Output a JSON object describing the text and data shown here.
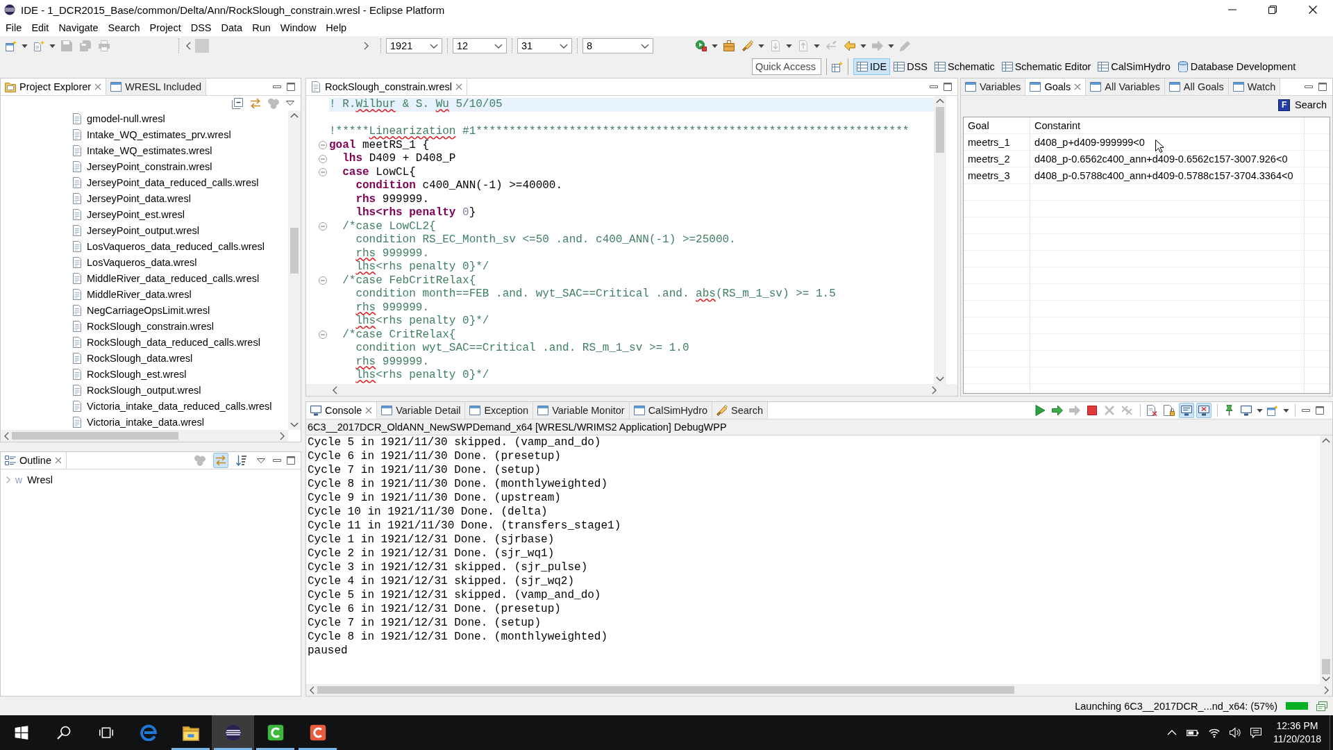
{
  "window": {
    "title": "IDE - 1_DCR2015_Base/common/Delta/Ann/RockSlough_constrain.wresl - Eclipse Platform"
  },
  "menu": [
    "File",
    "Edit",
    "Navigate",
    "Search",
    "Project",
    "DSS",
    "Data",
    "Run",
    "Window",
    "Help"
  ],
  "toolbar": {
    "tools_left": [
      {
        "kind": "new-window",
        "disabled": false,
        "dropdown": true
      },
      {
        "kind": "new-file",
        "disabled": false,
        "dropdown": true
      },
      {
        "kind": "save",
        "disabled": true,
        "dropdown": false
      },
      {
        "kind": "save-all",
        "disabled": true,
        "dropdown": false
      },
      {
        "kind": "print",
        "disabled": true,
        "dropdown": false
      }
    ],
    "combos": [
      {
        "value": "1921"
      },
      {
        "value": "12"
      },
      {
        "value": "31"
      },
      {
        "value": "8"
      }
    ],
    "tools_right": [
      {
        "kind": "run",
        "disabled": false,
        "dropdown": true
      },
      {
        "kind": "briefcase",
        "disabled": false,
        "dropdown": false
      },
      {
        "kind": "flashlight",
        "disabled": false,
        "dropdown": true
      },
      {
        "kind": "next-doc",
        "disabled": true,
        "dropdown": true
      },
      {
        "kind": "prev-doc",
        "disabled": true,
        "dropdown": true
      },
      {
        "kind": "arrow-pencil",
        "disabled": true,
        "dropdown": false
      },
      {
        "kind": "back",
        "disabled": false,
        "dropdown": true
      },
      {
        "kind": "forward",
        "disabled": true,
        "dropdown": true
      },
      {
        "kind": "pencil",
        "disabled": true,
        "dropdown": false
      }
    ],
    "quick_access": {
      "placeholder": "Quick Access"
    }
  },
  "perspectives": [
    {
      "label": "IDE",
      "kind": "table",
      "selected": true
    },
    {
      "label": "DSS",
      "kind": "table",
      "selected": false
    },
    {
      "label": "Schematic",
      "kind": "table",
      "selected": false
    },
    {
      "label": "Schematic Editor",
      "kind": "table",
      "selected": false
    },
    {
      "label": "CalSimHydro",
      "kind": "table",
      "selected": false
    },
    {
      "label": "Database Development",
      "kind": "database",
      "selected": false
    }
  ],
  "project_explorer": {
    "tabs": [
      {
        "label": "Project Explorer",
        "kind": "folder",
        "selected": true
      },
      {
        "label": "WRESL Included",
        "kind": "window",
        "selected": false
      }
    ],
    "tools": [
      {
        "kind": "collapse-all",
        "disabled": false
      },
      {
        "kind": "sync",
        "disabled": false
      },
      {
        "kind": "circles",
        "disabled": true
      },
      {
        "kind": "view-menu",
        "disabled": false
      }
    ],
    "files": [
      {
        "label": "gmodel-null.wresl",
        "selected": false
      },
      {
        "label": "Intake_WQ_estimates_prv.wresl",
        "selected": false
      },
      {
        "label": "Intake_WQ_estimates.wresl",
        "selected": false
      },
      {
        "label": "JerseyPoint_constrain.wresl",
        "selected": false
      },
      {
        "label": "JerseyPoint_data_reduced_calls.wresl",
        "selected": false
      },
      {
        "label": "JerseyPoint_data.wresl",
        "selected": false
      },
      {
        "label": "JerseyPoint_est.wresl",
        "selected": false
      },
      {
        "label": "JerseyPoint_output.wresl",
        "selected": false
      },
      {
        "label": "LosVaqueros_data_reduced_calls.wresl",
        "selected": false
      },
      {
        "label": "LosVaqueros_data.wresl",
        "selected": false
      },
      {
        "label": "MiddleRiver_data_reduced_calls.wresl",
        "selected": false
      },
      {
        "label": "MiddleRiver_data.wresl",
        "selected": false
      },
      {
        "label": "NegCarriageOpsLimit.wresl",
        "selected": false
      },
      {
        "label": "RockSlough_constrain.wresl",
        "selected": false
      },
      {
        "label": "RockSlough_data_reduced_calls.wresl",
        "selected": false
      },
      {
        "label": "RockSlough_data.wresl",
        "selected": false
      },
      {
        "label": "RockSlough_est.wresl",
        "selected": false
      },
      {
        "label": "RockSlough_output.wresl",
        "selected": false
      },
      {
        "label": "Victoria_intake_data_reduced_calls.wresl",
        "selected": false
      },
      {
        "label": "Victoria_intake_data.wresl",
        "selected": false
      }
    ]
  },
  "editor": {
    "tabs": [
      {
        "label": "RockSlough_constrain.wresl",
        "selected": true
      }
    ],
    "lines": [
      {
        "current": true,
        "fold": false,
        "tokens": [
          {
            "text": "! R.",
            "kind": "comment"
          },
          {
            "text": "Wilbur",
            "kind": "typo"
          },
          {
            "text": " & S. ",
            "kind": "comment"
          },
          {
            "text": "Wu",
            "kind": "typo"
          },
          {
            "text": " 5/10/05",
            "kind": "comment"
          }
        ]
      },
      {
        "current": false,
        "fold": false
      },
      {
        "current": false,
        "fold": false,
        "tokens": [
          {
            "text": "!*****",
            "kind": "comment"
          },
          {
            "text": "Linearization",
            "kind": "typo"
          },
          {
            "text": " #1*****************************************************************",
            "kind": "comment"
          }
        ]
      },
      {
        "current": false,
        "fold": true,
        "tokens": [
          {
            "text": "goal",
            "kind": "keyword"
          },
          {
            "text": " meetRS_1 {",
            "kind": "plain"
          }
        ]
      },
      {
        "current": false,
        "fold": true,
        "tokens": [
          {
            "text": "  lhs",
            "kind": "keyword"
          },
          {
            "text": " D409 + D408_P",
            "kind": "plain"
          }
        ]
      },
      {
        "current": false,
        "fold": true,
        "tokens": [
          {
            "text": "  case",
            "kind": "keyword"
          },
          {
            "text": " LowCL{",
            "kind": "plain"
          }
        ]
      },
      {
        "current": false,
        "fold": false,
        "tokens": [
          {
            "text": "    condition",
            "kind": "keyword"
          },
          {
            "text": " c400_ANN(-1) >=40000.",
            "kind": "plain"
          }
        ]
      },
      {
        "current": false,
        "fold": false,
        "tokens": [
          {
            "text": "    rhs",
            "kind": "keyword"
          },
          {
            "text": " 999999.",
            "kind": "plain"
          }
        ]
      },
      {
        "current": false,
        "fold": false,
        "tokens": [
          {
            "text": "    lhs<rhs penalty",
            "kind": "keyword"
          },
          {
            "text": " 0",
            "kind": "number"
          },
          {
            "text": "}",
            "kind": "plain"
          }
        ]
      },
      {
        "current": false,
        "fold": true,
        "tokens": [
          {
            "text": "  /*case LowCL2{",
            "kind": "comment"
          }
        ]
      },
      {
        "current": false,
        "fold": false,
        "tokens": [
          {
            "text": "    condition RS_EC_Month_sv <=50 .and. c400_ANN(-1) >=25000.",
            "kind": "comment"
          }
        ]
      },
      {
        "current": false,
        "fold": false,
        "tokens": [
          {
            "text": "    rhs",
            "kind": "typo"
          },
          {
            "text": " 999999.",
            "kind": "comment"
          }
        ]
      },
      {
        "current": false,
        "fold": false,
        "tokens": [
          {
            "text": "    lhs",
            "kind": "typo"
          },
          {
            "text": "<rhs penalty 0}*/",
            "kind": "comment"
          }
        ]
      },
      {
        "current": false,
        "fold": true,
        "tokens": [
          {
            "text": "  /*case FebCritRelax{",
            "kind": "comment"
          }
        ]
      },
      {
        "current": false,
        "fold": false,
        "tokens": [
          {
            "text": "    condition month==FEB .and. wyt_SAC==Critical .and. ",
            "kind": "comment"
          },
          {
            "text": "abs",
            "kind": "typo"
          },
          {
            "text": "(RS_m_1_sv) >= 1.5",
            "kind": "comment"
          }
        ]
      },
      {
        "current": false,
        "fold": false,
        "tokens": [
          {
            "text": "    rhs",
            "kind": "typo"
          },
          {
            "text": " 999999.",
            "kind": "comment"
          }
        ]
      },
      {
        "current": false,
        "fold": false,
        "tokens": [
          {
            "text": "    lhs",
            "kind": "typo"
          },
          {
            "text": "<rhs penalty 0}*/",
            "kind": "comment"
          }
        ]
      },
      {
        "current": false,
        "fold": true,
        "tokens": [
          {
            "text": "  /*case CritRelax{",
            "kind": "comment"
          }
        ]
      },
      {
        "current": false,
        "fold": false,
        "tokens": [
          {
            "text": "    condition wyt_SAC==Critical .and. RS_m_1_sv >= 1.0",
            "kind": "comment"
          }
        ]
      },
      {
        "current": false,
        "fold": false,
        "tokens": [
          {
            "text": "    rhs",
            "kind": "typo"
          },
          {
            "text": " 999999.",
            "kind": "comment"
          }
        ]
      },
      {
        "current": false,
        "fold": false,
        "tokens": [
          {
            "text": "    lhs",
            "kind": "typo"
          },
          {
            "text": "<rhs penalty 0}*/",
            "kind": "comment"
          }
        ]
      }
    ]
  },
  "goals_view": {
    "tabs": [
      {
        "label": "Variables",
        "selected": false
      },
      {
        "label": "Goals",
        "selected": true
      },
      {
        "label": "All Variables",
        "selected": false
      },
      {
        "label": "All Goals",
        "selected": false
      },
      {
        "label": "Watch",
        "selected": false
      }
    ],
    "search": {
      "icon": "F",
      "label": "Search"
    },
    "columns": [
      "Goal",
      "Constarint"
    ],
    "rows": [
      [
        "meetrs_1",
        "d408_p+d409-999999<0"
      ],
      [
        "meetrs_2",
        "d408_p-0.6562c400_ann+d409-0.6562c157-3007.926<0"
      ],
      [
        "meetrs_3",
        "d408_p-0.5788c400_ann+d409-0.5788c157-3704.3364<0"
      ]
    ]
  },
  "console": {
    "tabs": [
      {
        "label": "Console",
        "kind": "monitor",
        "selected": true
      },
      {
        "label": "Variable Detail",
        "kind": "window",
        "selected": false
      },
      {
        "label": "Exception",
        "kind": "window",
        "selected": false
      },
      {
        "label": "Variable Monitor",
        "kind": "window",
        "selected": false
      },
      {
        "label": "CalSimHydro",
        "kind": "window",
        "selected": false
      },
      {
        "label": "Search",
        "kind": "flashlight",
        "selected": false
      }
    ],
    "tool_groups": [
      [
        {
          "kind": "play",
          "disabled": false,
          "pressed": false,
          "dropdown": false
        },
        {
          "kind": "step",
          "disabled": false,
          "pressed": false,
          "dropdown": false
        },
        {
          "kind": "step",
          "disabled": true,
          "pressed": false,
          "dropdown": false
        },
        {
          "kind": "stop",
          "disabled": false,
          "pressed": false,
          "dropdown": false
        },
        {
          "kind": "x-mark",
          "disabled": true,
          "pressed": false,
          "dropdown": false
        },
        {
          "kind": "double-x",
          "disabled": true,
          "pressed": false,
          "dropdown": false
        }
      ],
      [
        {
          "kind": "doc-x",
          "disabled": false,
          "pressed": false,
          "dropdown": false
        },
        {
          "kind": "doc-lock",
          "disabled": false,
          "pressed": false,
          "dropdown": false
        },
        {
          "kind": "console-lines",
          "disabled": false,
          "pressed": true,
          "dropdown": false
        },
        {
          "kind": "console-x",
          "disabled": false,
          "pressed": true,
          "dropdown": false
        }
      ],
      [
        {
          "kind": "pin",
          "disabled": false,
          "pressed": false,
          "dropdown": false
        },
        {
          "kind": "monitor",
          "disabled": false,
          "pressed": false,
          "dropdown": true
        },
        {
          "kind": "new-window",
          "disabled": false,
          "pressed": false,
          "dropdown": true
        }
      ]
    ],
    "process": "6C3__2017DCR_OldANN_NewSWPDemand_x64 [WRESL/WRIMS2 Application] DebugWPP",
    "lines": [
      "Cycle 5 in 1921/11/30 skipped. (vamp_and_do)",
      "Cycle 6 in 1921/11/30 Done. (presetup)",
      "Cycle 7 in 1921/11/30 Done. (setup)",
      "Cycle 8 in 1921/11/30 Done. (monthlyweighted)",
      "Cycle 9 in 1921/11/30 Done. (upstream)",
      "Cycle 10 in 1921/11/30 Done. (delta)",
      "Cycle 11 in 1921/11/30 Done. (transfers_stage1)",
      "Cycle 1 in 1921/12/31 Done. (sjrbase)",
      "Cycle 2 in 1921/12/31 Done. (sjr_wq1)",
      "Cycle 3 in 1921/12/31 skipped. (sjr_pulse)",
      "Cycle 4 in 1921/12/31 skipped. (sjr_wq2)",
      "Cycle 5 in 1921/12/31 skipped. (vamp_and_do)",
      "Cycle 6 in 1921/12/31 Done. (presetup)",
      "Cycle 7 in 1921/12/31 Done. (setup)",
      "Cycle 8 in 1921/12/31 Done. (monthlyweighted)",
      "paused"
    ]
  },
  "outline": {
    "tabs": [
      {
        "label": "Outline",
        "selected": true
      }
    ],
    "tools": [
      {
        "kind": "circles",
        "disabled": true,
        "pressed": false
      },
      {
        "kind": "sync",
        "disabled": false,
        "pressed": true
      },
      {
        "kind": "sort",
        "disabled": false,
        "pressed": false
      },
      {
        "kind": "view-menu",
        "disabled": false,
        "pressed": false
      }
    ],
    "tree": [
      {
        "label": "Wresl",
        "glyph": "w",
        "expanded": false
      }
    ]
  },
  "status_bar": {
    "message": "Launching 6C3__2017DCR_...nd_x64: (57%)",
    "progress": {
      "level": 1
    }
  },
  "taskbar": {
    "buttons": [
      {
        "kind": "start"
      },
      {
        "kind": "search"
      },
      {
        "kind": "task-view"
      }
    ],
    "apps": [
      {
        "kind": "browser",
        "running": false,
        "selected": false
      },
      {
        "kind": "folder",
        "running": true,
        "selected": false
      },
      {
        "kind": "eclipse",
        "running": true,
        "selected": true
      },
      {
        "kind": "c-app",
        "color": "#3db83d",
        "running": true,
        "selected": false
      },
      {
        "kind": "c-app",
        "color": "#ea5a3c",
        "running": true,
        "selected": false
      }
    ],
    "clock": {
      "time": "12:36 PM",
      "date": "11/20/2018"
    }
  }
}
